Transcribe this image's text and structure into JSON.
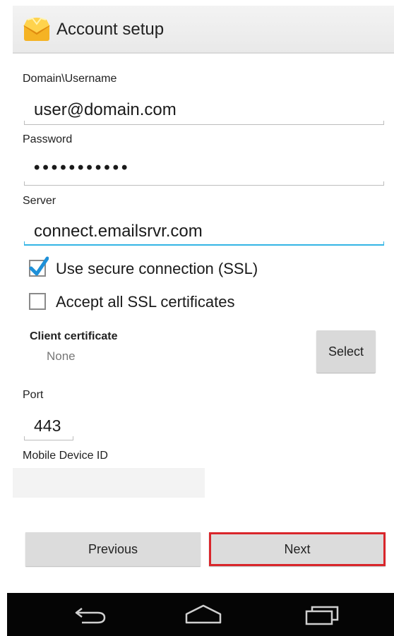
{
  "action_bar": {
    "title": "Account setup",
    "icon": "email-app-icon"
  },
  "form": {
    "domain_username": {
      "label": "Domain\\Username",
      "value": "user@domain.com"
    },
    "password": {
      "label": "Password",
      "value": "•••••••••••"
    },
    "server": {
      "label": "Server",
      "value": "connect.emailsrvr.com"
    },
    "ssl": {
      "label": "Use secure connection (SSL)",
      "checked": true
    },
    "accept_all": {
      "label": "Accept all SSL certificates",
      "checked": false
    },
    "client_certificate": {
      "label": "Client certificate",
      "value": "None",
      "button": "Select"
    },
    "port": {
      "label": "Port",
      "value": "443"
    },
    "mobile_device_id": {
      "label": "Mobile Device ID",
      "value": ""
    }
  },
  "buttons": {
    "previous": "Previous",
    "next": "Next"
  },
  "colors": {
    "accent": "#33b5e5",
    "highlight": "#d9262b",
    "checkmark": "#1e90d8"
  },
  "nav_bar": {
    "back": "back-icon",
    "home": "home-icon",
    "recents": "recents-icon"
  }
}
